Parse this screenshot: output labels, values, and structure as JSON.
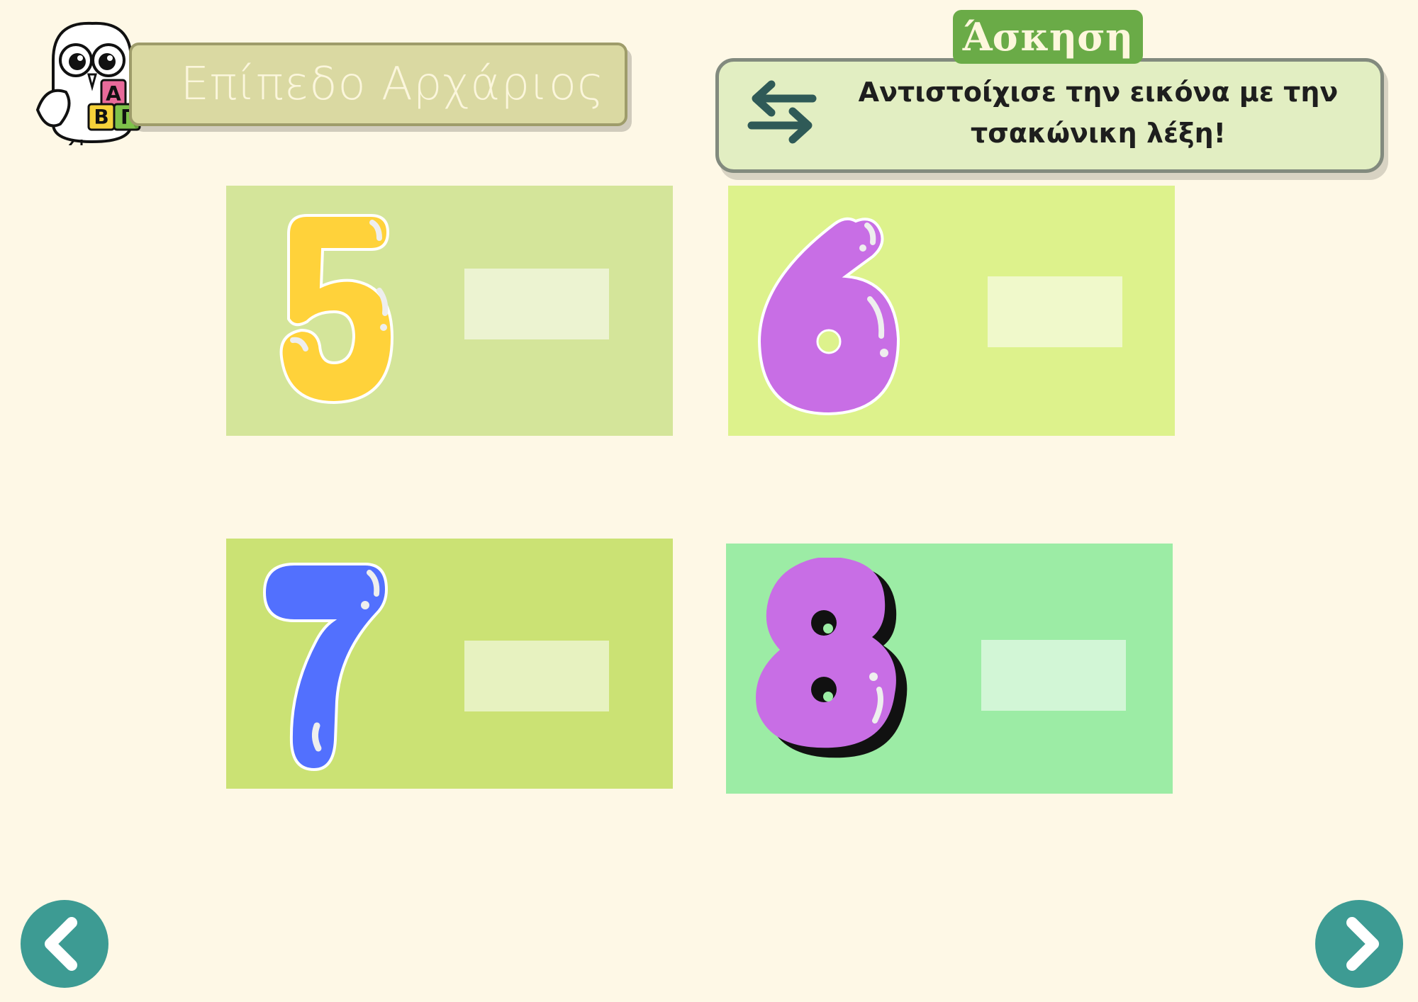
{
  "header": {
    "level_title": "Επίπεδο Αρχάριος",
    "logo_blocks": [
      "Α",
      "Β",
      "Γ"
    ]
  },
  "exercise": {
    "tag_label": "Άσκηση",
    "instruction": "Αντιστοίχισε την εικόνα με την τσακώνικη λέξη!"
  },
  "cards": [
    {
      "numeral": "5",
      "numeral_color": "#ffd23a",
      "background": "#d4e59a",
      "answer": ""
    },
    {
      "numeral": "6",
      "numeral_color": "#c86ee5",
      "background": "#ddf28c",
      "answer": ""
    },
    {
      "numeral": "7",
      "numeral_color": "#5270fe",
      "background": "#cbe274",
      "answer": ""
    },
    {
      "numeral": "8",
      "numeral_color": "#c86ee5",
      "background": "#9ceca5",
      "answer": ""
    }
  ],
  "navigation": {
    "prev_icon": "chevron-left-icon",
    "next_icon": "chevron-right-icon",
    "button_color": "#3d9b93"
  },
  "colors": {
    "page_background": "#fef8e6",
    "exercise_tag": "#6aab47",
    "instruction_box": "#e2eec2"
  }
}
